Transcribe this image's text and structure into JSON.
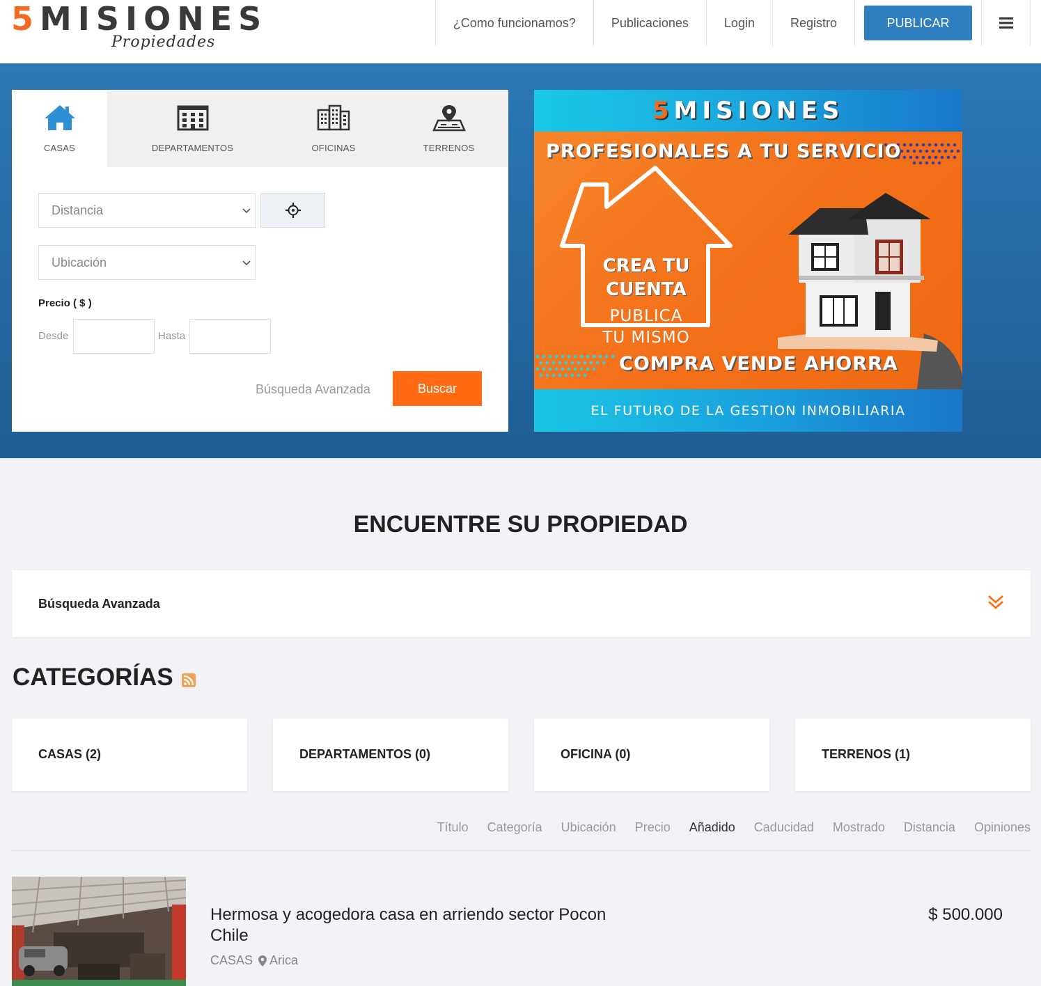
{
  "logo": {
    "five": "5",
    "name": "MISIONES",
    "sub": "Propiedades"
  },
  "nav": {
    "items": [
      "¿Como funcionamos?",
      "Publicaciones",
      "Login",
      "Registro"
    ],
    "publicar": "PUBLICAR"
  },
  "search": {
    "tabs": [
      "CASAS",
      "DEPARTAMENTOS",
      "OFICINAS",
      "TERRENOS"
    ],
    "distancia_placeholder": "Distancia",
    "ubicacion_placeholder": "Ubicación",
    "precio_label": "Precio ( $ )",
    "desde": "Desde",
    "hasta": "Hasta",
    "advanced_link": "Búsqueda Avanzada",
    "buscar": "Buscar"
  },
  "banner": {
    "logo_five": "5",
    "logo_name": "MISIONES",
    "title": "PROFESIONALES A TU SERVICIO",
    "crea_line1": "CREA TU",
    "crea_line2": "CUENTA",
    "publica_line1": "PUBLICA",
    "publica_line2": "TU MISMO",
    "compra": "COMPRA VENDE AHORRA",
    "footer": "EL FUTURO DE LA GESTION INMOBILIARIA"
  },
  "main": {
    "title": "ENCUENTRE SU PROPIEDAD",
    "advanced_bar": "Búsqueda Avanzada",
    "categories_title": "CATEGORÍAS",
    "categories": [
      "CASAS (2)",
      "DEPARTAMENTOS (0)",
      "OFICINA (0)",
      "TERRENOS (1)"
    ],
    "sort": [
      "Título",
      "Categoría",
      "Ubicación",
      "Precio",
      "Añadido",
      "Caducidad",
      "Mostrado",
      "Distancia",
      "Opiniones"
    ],
    "sort_active": "Añadido"
  },
  "listing": {
    "title": "Hermosa y acogedora casa en arriendo sector Pocon Chile",
    "category": "CASAS",
    "location": "Arica",
    "price": "$ 500.000"
  },
  "colors": {
    "brand_blue": "#2f7fc1",
    "brand_orange": "#ff6a13",
    "accent_orange_logo": "#f26a21"
  }
}
